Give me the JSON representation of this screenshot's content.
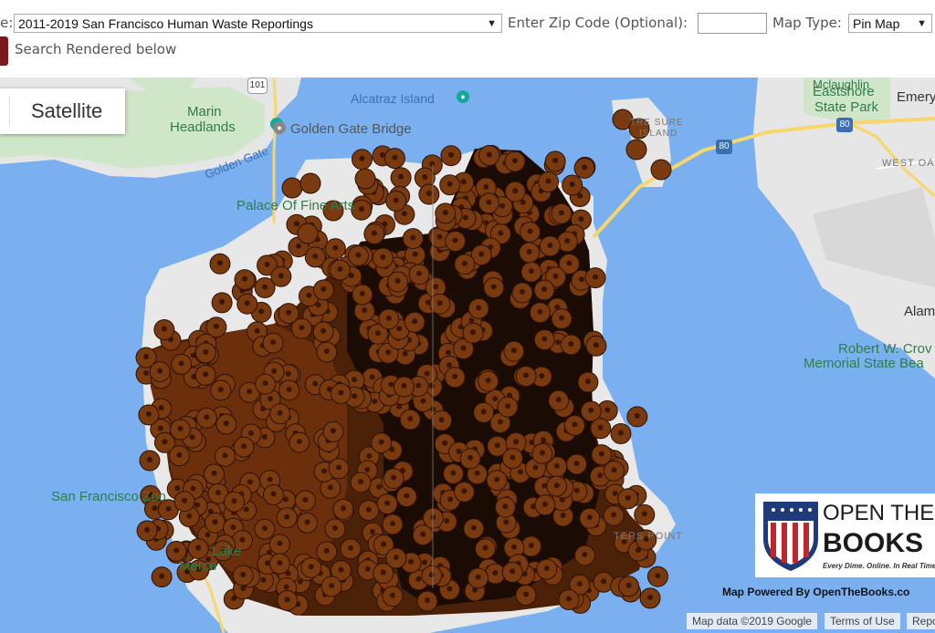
{
  "toolbar": {
    "dataset_label": "e:",
    "dataset_value": "2011-2019 San Francisco Human Waste Reportings",
    "zip_label": "Enter Zip Code (Optional):",
    "zip_value": "",
    "map_type_label": "Map Type:",
    "map_type_value": "Pin Map",
    "status": "Search Rendered below"
  },
  "map": {
    "map_type_button": "Satellite",
    "labels": {
      "alcatraz": "Alcatraz Island",
      "marin": "Marin",
      "headlands": "Headlands",
      "golden_gate_bridge": "Golden Gate Bridge",
      "golden_gate": "Golden Gate",
      "palace": "Palace Of Fine Arts",
      "treasure_island_1": "TRE  SURE",
      "treasure_island_2": "ISLAND",
      "mclaughlin": "Mclaughlin",
      "eastshore": "Eastshore",
      "state_park": "State Park",
      "emeryville": "Emeryvi",
      "west_oakland": "WEST OA",
      "alameda": "Alam",
      "crown_1": "Robert W. Crov",
      "crown_2": "Memorial State Bea",
      "sf_zoo": "San Francisco Zoo",
      "lake_merced_1": "Lake",
      "lake_merced_2": "Merce",
      "hunters_point": "TERS POINT"
    },
    "highway_shields": [
      "101",
      "80",
      "80"
    ],
    "logo": {
      "line1": "OPEN THE",
      "line2": "BOOKS",
      "tagline": "Every Dime. Online. In Real Time."
    },
    "powered_by": "Map Powered By OpenTheBooks.co",
    "attribution": {
      "map_data": "Map data ©2019 Google",
      "terms": "Terms of Use",
      "report": "Repo"
    },
    "pin_color": "#7a3a10",
    "water_color": "#7ab0f0",
    "land_color": "#e8e8e8"
  }
}
